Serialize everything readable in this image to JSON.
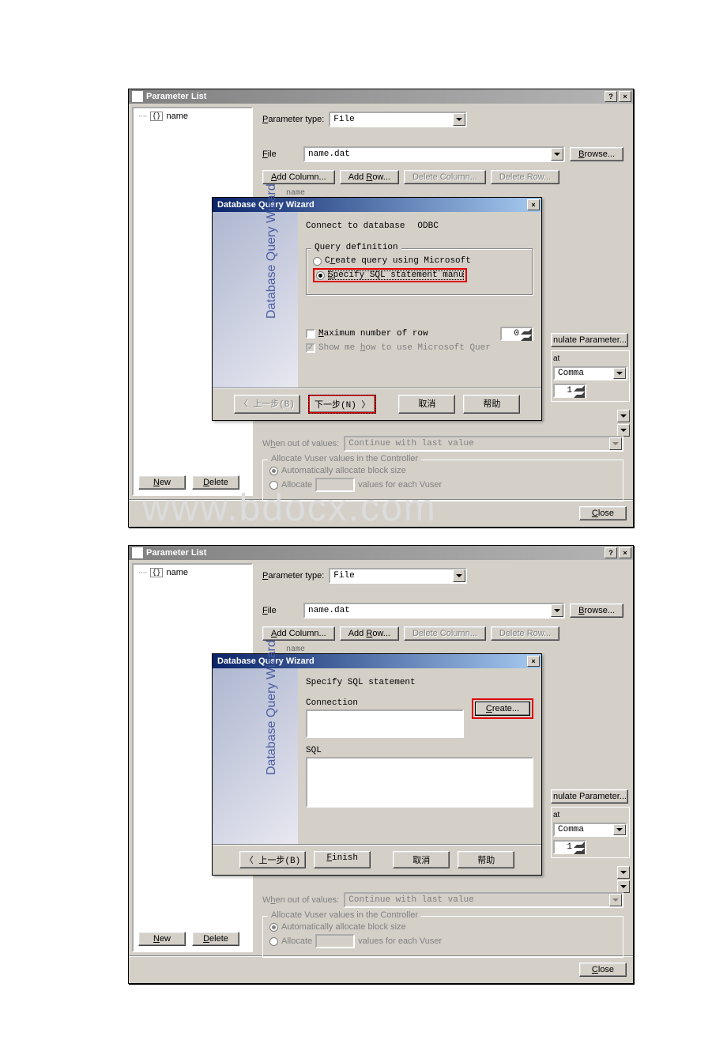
{
  "watermark": "www.bdocx.com",
  "screenshot1": {
    "parameter_window": {
      "title": "Parameter List",
      "help_btn": "?",
      "close_btn": "×",
      "tree_item": "name",
      "btn_new": "New",
      "btn_delete": "Delete",
      "param_type_label": "Parameter type:",
      "param_type_value": "File",
      "file_label": "File",
      "file_value": "name.dat",
      "browse": "Browse...",
      "add_column": "Add Column...",
      "add_row": "Add Row...",
      "delete_column": "Delete Column...",
      "delete_row": "Delete Row...",
      "col_header": "name",
      "frag_nulate": "nulate Parameter...",
      "frag_at": "at",
      "frag_comma": "Comma",
      "frag_one": "1",
      "when_out": "When out of values:",
      "when_out_val": "Continue with last value",
      "alloc_title": "Allocate Vuser values in the Controller",
      "alloc_auto": "Automatically allocate block size",
      "alloc_manual": "Allocate",
      "alloc_suffix": "values for each Vuser",
      "btn_close": "Close"
    },
    "wizard": {
      "title": "Database Query Wizard",
      "banner": "Database Query Wizard",
      "connect_label": "Connect to database",
      "connect_value": "ODBC",
      "group_title": "Query definition",
      "opt_ms": "Create query using Microsoft",
      "opt_manual": "Specify SQL statement manu",
      "max_rows": "Maximum number of row",
      "max_rows_val": "0",
      "show_me": "Show me how to use Microsoft Quer",
      "btn_back": "〈 上一步(B)",
      "btn_next": "下一步(N) 〉",
      "btn_cancel": "取消",
      "btn_help": "帮助"
    }
  },
  "screenshot2": {
    "parameter_window": {
      "title": "Parameter List",
      "help_btn": "?",
      "close_btn": "×",
      "tree_item": "name",
      "btn_new": "New",
      "btn_delete": "Delete",
      "param_type_label": "Parameter type:",
      "param_type_value": "File",
      "file_label": "File",
      "file_value": "name.dat",
      "browse": "Browse...",
      "add_column": "Add Column...",
      "add_row": "Add Row...",
      "delete_column": "Delete Column...",
      "delete_row": "Delete Row...",
      "col_header": "name",
      "frag_nulate": "nulate Parameter...",
      "frag_at": "at",
      "frag_comma": "Comma",
      "frag_one": "1",
      "when_out": "When out of values:",
      "when_out_val": "Continue with last value",
      "alloc_title": "Allocate Vuser values in the Controller",
      "alloc_auto": "Automatically allocate block size",
      "alloc_manual": "Allocate",
      "alloc_suffix": "values for each Vuser",
      "btn_close": "Close"
    },
    "wizard": {
      "title": "Database Query Wizard",
      "banner": "Database Query Wizard",
      "heading": "Specify SQL statement",
      "connection": "Connection",
      "create": "Create...",
      "sql": "SQL",
      "btn_back": "〈 上一步(B)",
      "btn_finish": "Finish",
      "btn_cancel": "取消",
      "btn_help": "帮助"
    }
  }
}
